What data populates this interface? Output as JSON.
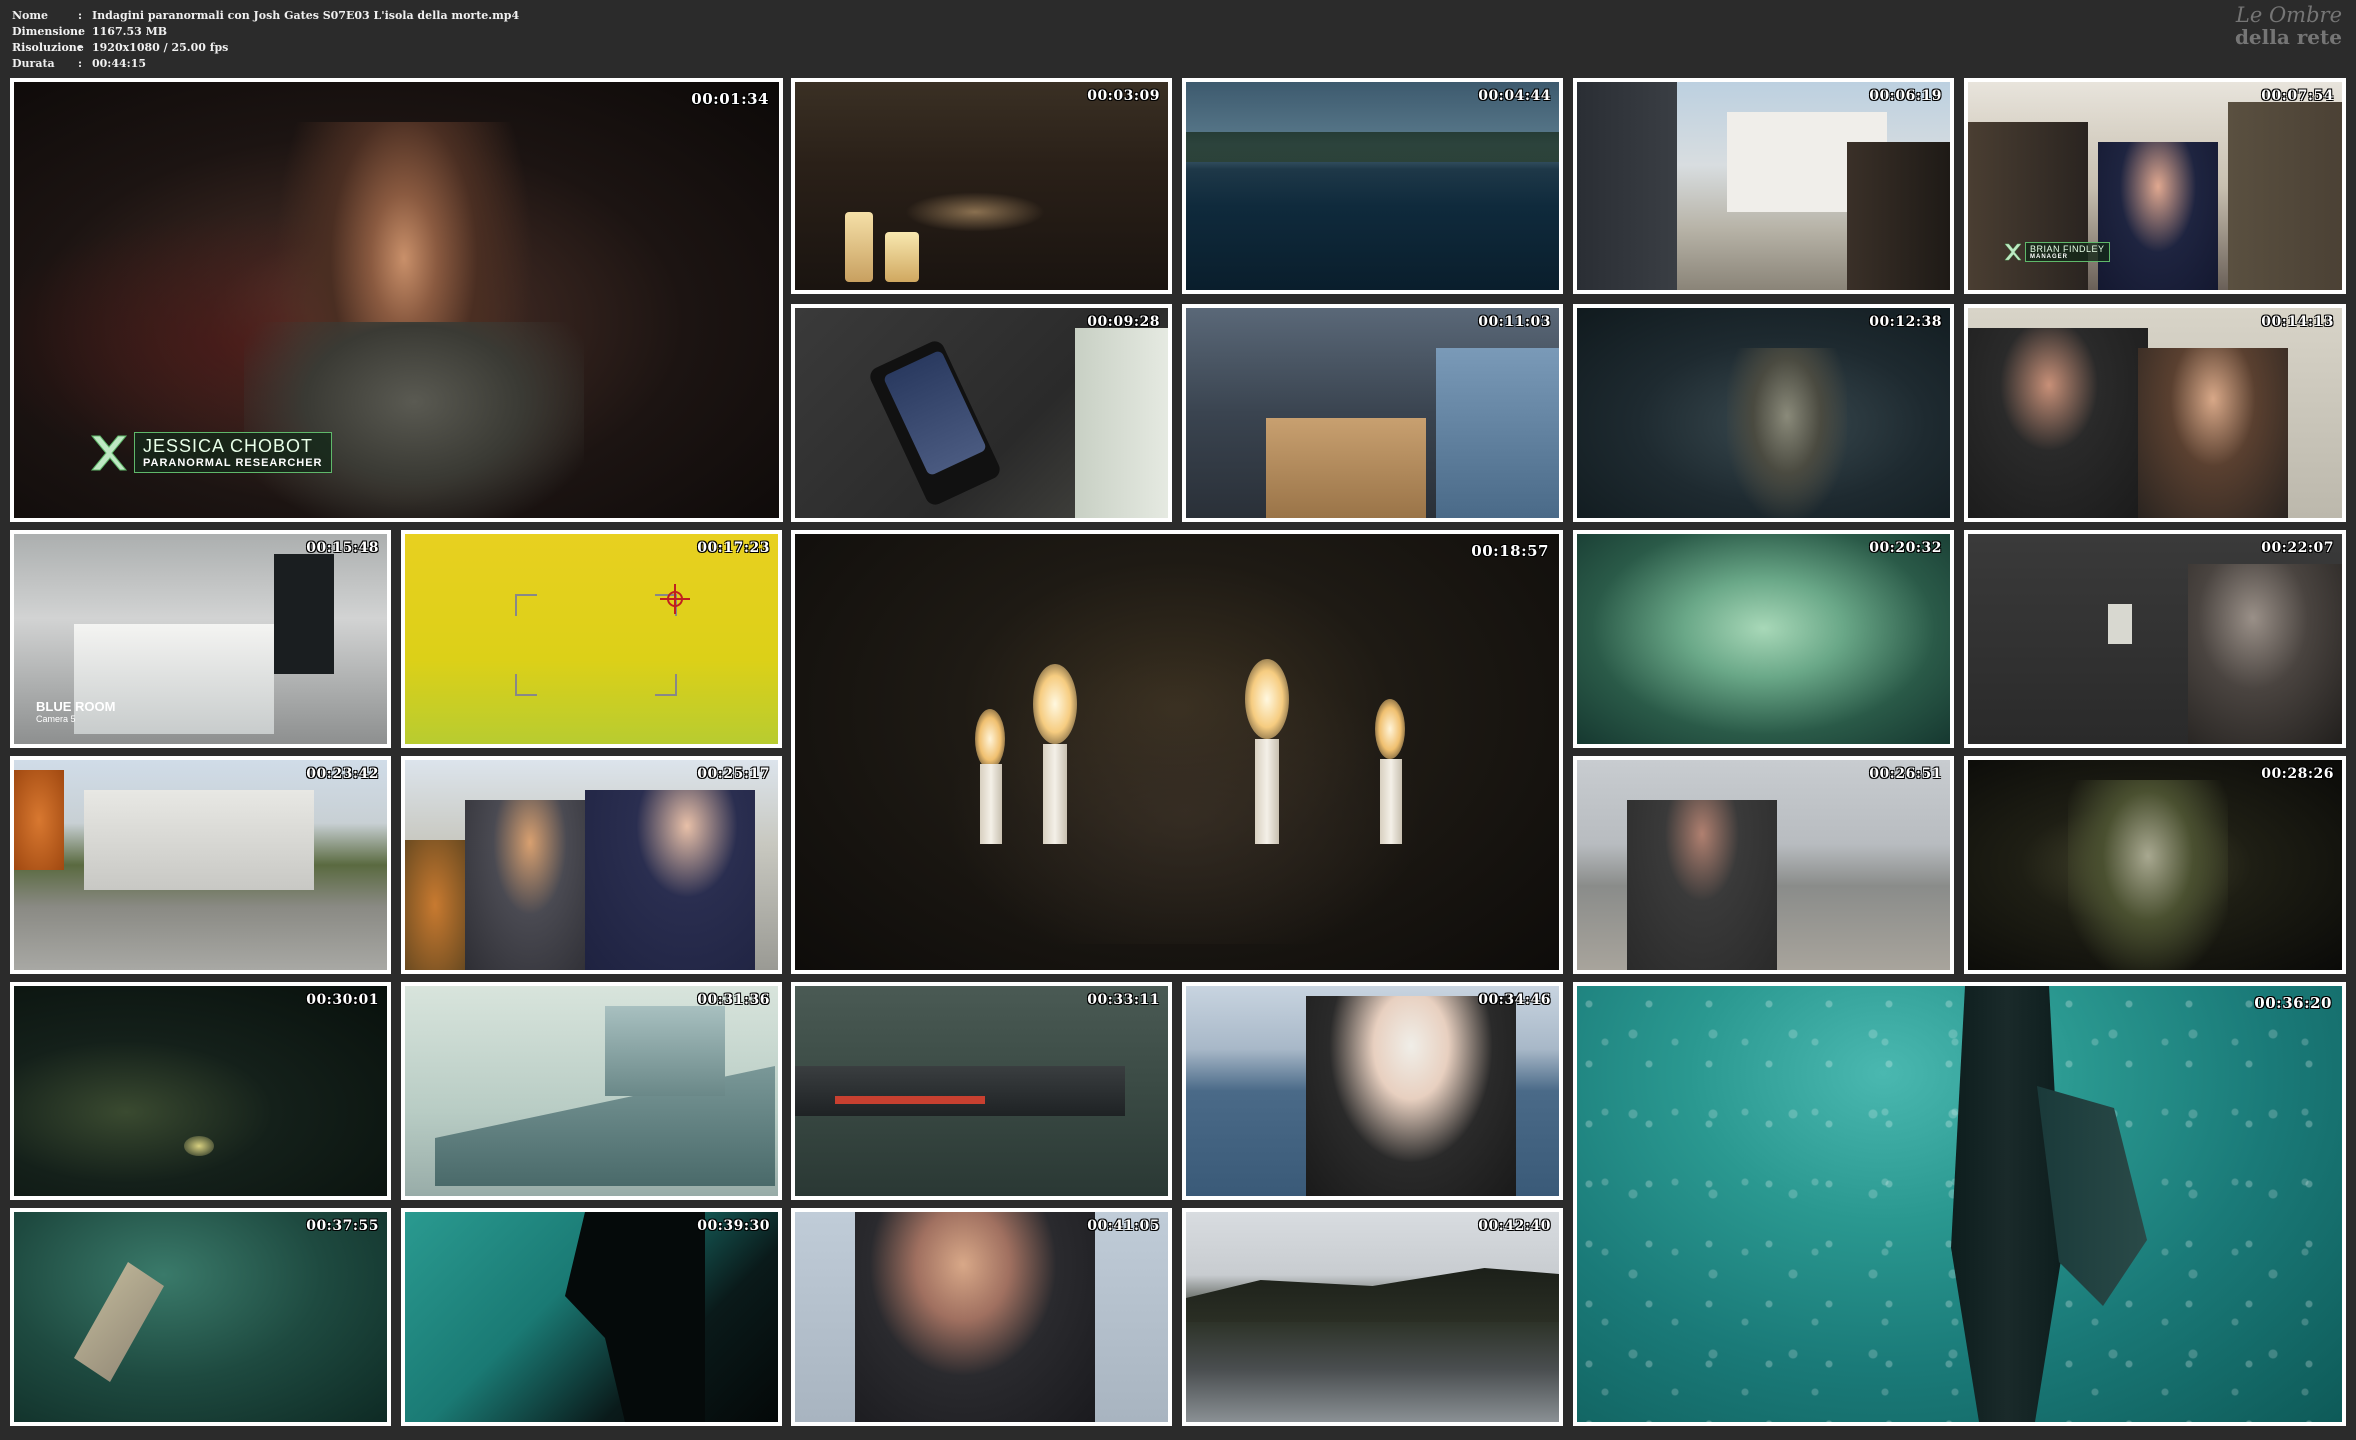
{
  "info": {
    "rows": [
      {
        "label": "Nome",
        "value": "Indagini paranormali con Josh Gates S07E03 L'isola della morte.mp4"
      },
      {
        "label": "Dimensione",
        "value": "1167.53 MB"
      },
      {
        "label": "Risoluzione",
        "value": "1920x1080 / 25.00 fps"
      },
      {
        "label": "Durata",
        "value": "00:44:15"
      }
    ],
    "separator": ":"
  },
  "watermark": {
    "line1": "Le Ombre",
    "line2": "della rete"
  },
  "thumbnails": [
    {
      "timestamp": "00:01:34"
    },
    {
      "timestamp": "00:03:09"
    },
    {
      "timestamp": "00:04:44"
    },
    {
      "timestamp": "00:06:19"
    },
    {
      "timestamp": "00:07:54"
    },
    {
      "timestamp": "00:09:28"
    },
    {
      "timestamp": "00:11:03"
    },
    {
      "timestamp": "00:12:38"
    },
    {
      "timestamp": "00:14:13"
    },
    {
      "timestamp": "00:15:48"
    },
    {
      "timestamp": "00:17:23"
    },
    {
      "timestamp": "00:18:57"
    },
    {
      "timestamp": "00:20:32"
    },
    {
      "timestamp": "00:22:07"
    },
    {
      "timestamp": "00:23:42"
    },
    {
      "timestamp": "00:25:17"
    },
    {
      "timestamp": "00:26:51"
    },
    {
      "timestamp": "00:28:26"
    },
    {
      "timestamp": "00:30:01"
    },
    {
      "timestamp": "00:31:36"
    },
    {
      "timestamp": "00:33:11"
    },
    {
      "timestamp": "00:34:46"
    },
    {
      "timestamp": "00:36:20"
    },
    {
      "timestamp": "00:37:55"
    },
    {
      "timestamp": "00:39:30"
    },
    {
      "timestamp": "00:41:05"
    },
    {
      "timestamp": "00:42:40"
    }
  ],
  "overlays": {
    "jessica": {
      "name": "JESSICA CHOBOT",
      "role": "PARANORMAL RESEARCHER"
    },
    "brian": {
      "name": "BRIAN FINDLEY",
      "role": "MANAGER"
    },
    "camera": {
      "room": "BLUE ROOM",
      "camera": "Camera 5"
    }
  }
}
